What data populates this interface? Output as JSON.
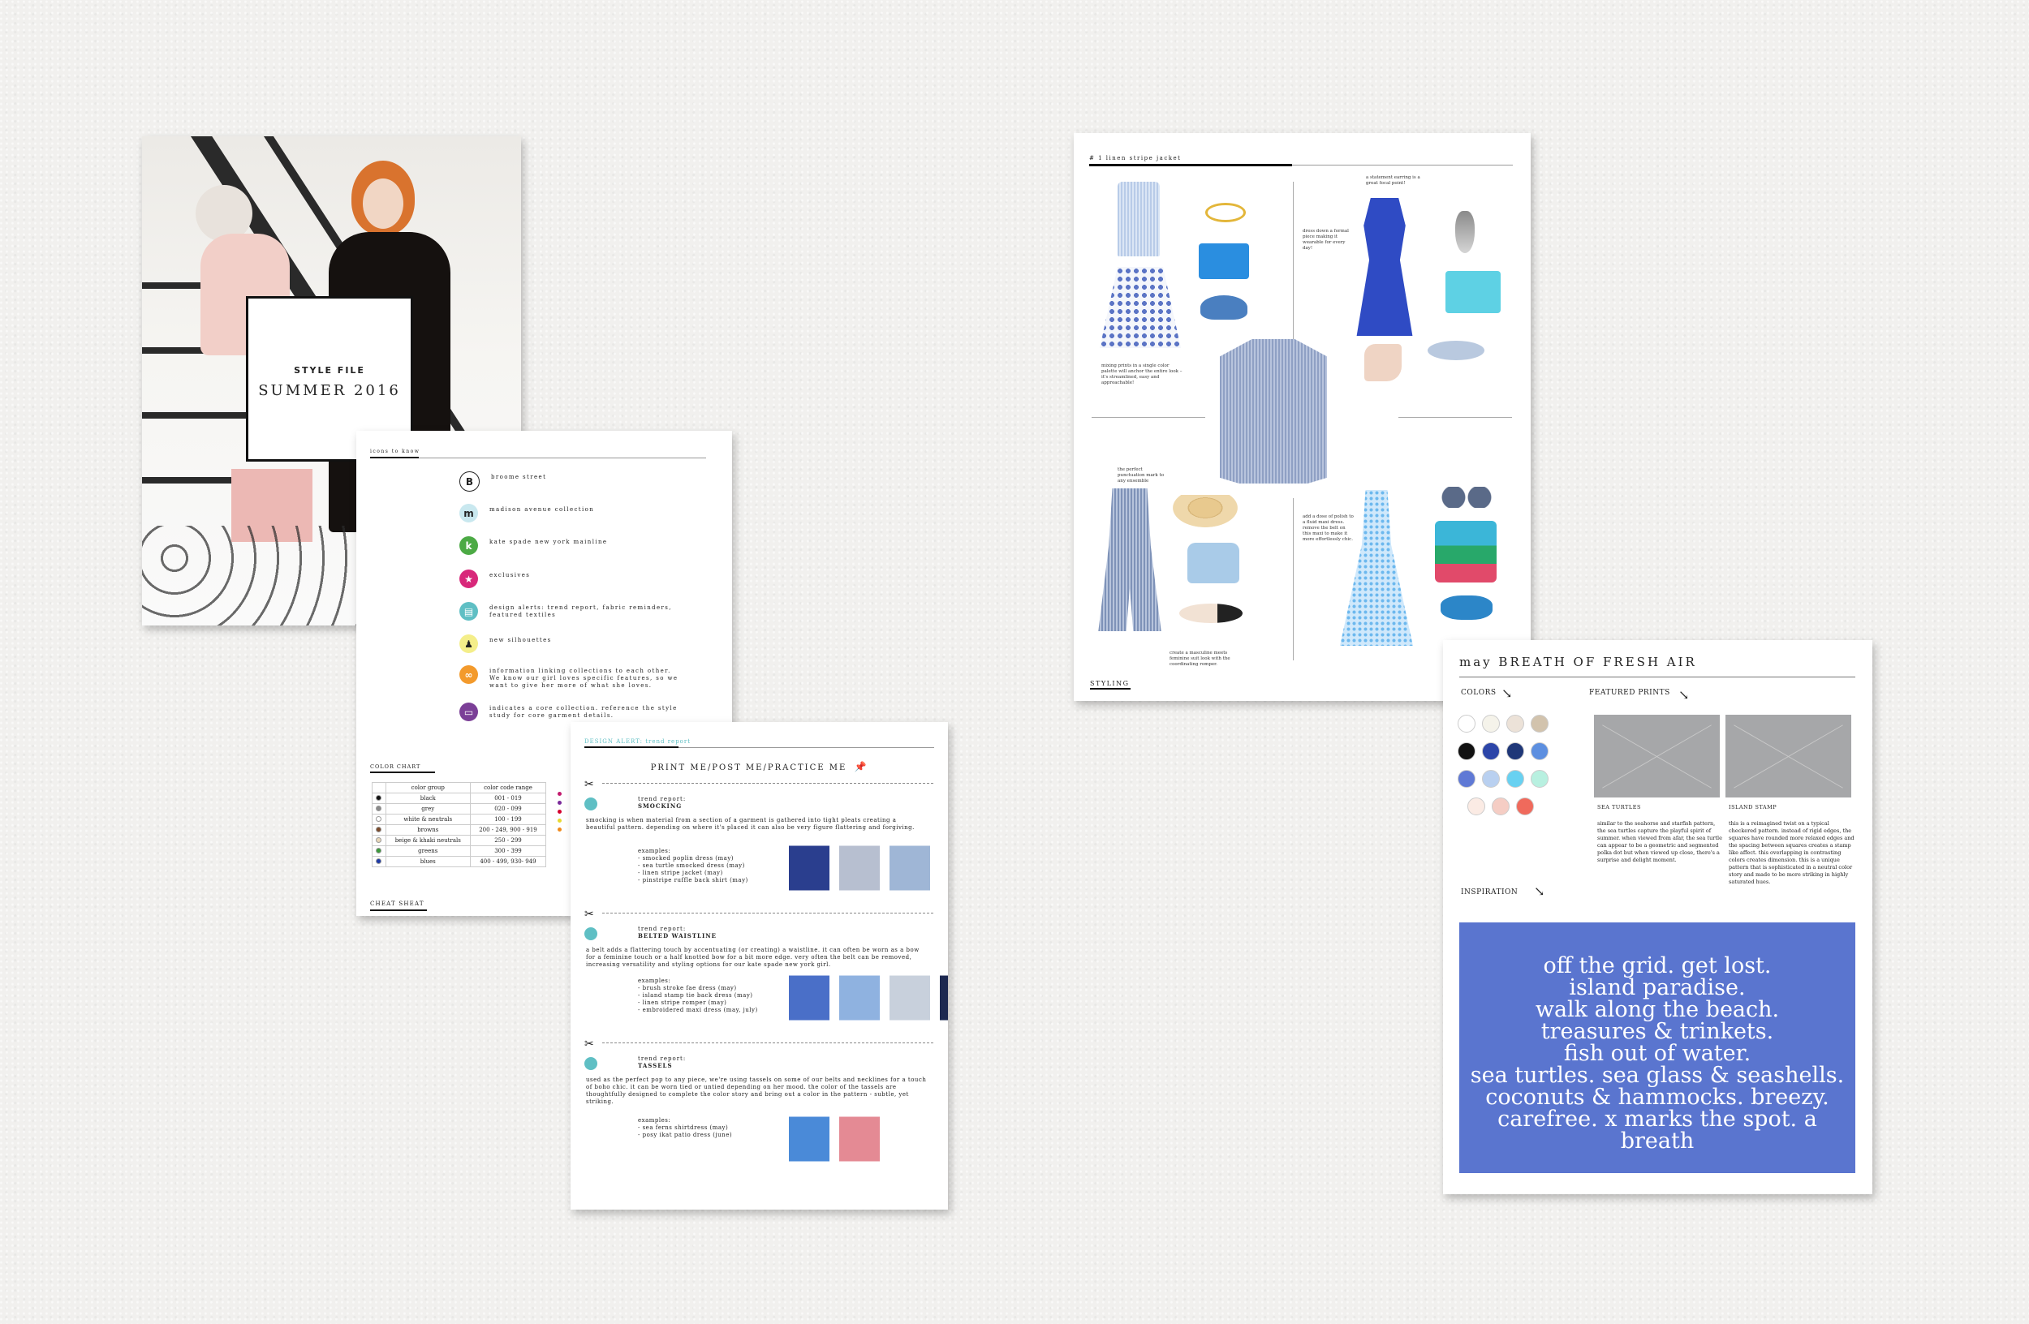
{
  "cover": {
    "line1": "STYLE FILE",
    "line2": "SUMMER 2016"
  },
  "icons_sheet": {
    "header": "icons to know",
    "items": [
      {
        "icon": "letter-b-icon",
        "glyph": "B",
        "color": "#ffffff",
        "text": "broome street"
      },
      {
        "icon": "script-m-icon",
        "glyph": "m",
        "color": "#c9e8ef",
        "text": "madison avenue collection"
      },
      {
        "icon": "letter-k-icon",
        "glyph": "k",
        "color": "#4caa45",
        "text": "kate spade new york mainline"
      },
      {
        "icon": "star-icon",
        "glyph": "★",
        "color": "#d8287a",
        "text": "exclusives"
      },
      {
        "icon": "design-alert-icon",
        "glyph": "▤",
        "color": "#5fbfc4",
        "text": "design alerts: trend report, fabric reminders, featured textiles"
      },
      {
        "icon": "dress-form-icon",
        "glyph": "♟",
        "color": "#f4ee8a",
        "text": "new silhouettes"
      },
      {
        "icon": "link-icon",
        "glyph": "∞",
        "color": "#f39a2c",
        "text": "information linking collections to each other. We know our girl loves specific features, so we want to give her more of what she loves."
      },
      {
        "icon": "core-collection-icon",
        "glyph": "▭",
        "color": "#7b3f97",
        "text": "indicates a core collection. reference the style study for core garment details."
      }
    ],
    "color_chart_title": "COLOR CHART",
    "color_chart_headers": [
      "color group",
      "color code range"
    ],
    "color_chart_rows": [
      {
        "dot": "#111111",
        "group": "black",
        "range": "001 - 019"
      },
      {
        "dot": "#8a8a8a",
        "group": "grey",
        "range": "020 - 099"
      },
      {
        "dot": "#ffffff",
        "group": "white & neutrals",
        "range": "100 - 199"
      },
      {
        "dot": "#7a4a2a",
        "group": "browns",
        "range": "200 - 249, 900 - 919"
      },
      {
        "dot": "#e8d7b8",
        "group": "beige & khaki neutrals",
        "range": "250 - 299"
      },
      {
        "dot": "#3a9a3a",
        "group": "greens",
        "range": "300 - 399"
      },
      {
        "dot": "#1d3aa8",
        "group": "blues",
        "range": "400 - 499, 930- 949"
      }
    ],
    "color_chart_extra_dots": [
      "#c21b6e",
      "#7a2a9a",
      "#d4002e",
      "#e8d930",
      "#f08a1c"
    ],
    "footer": "CHEAT SHEAT"
  },
  "print_sheet": {
    "kicker": "DESIGN ALERT: trend report",
    "title": "PRINT ME/POST ME/PRACTICE ME",
    "sections": [
      {
        "label": "trend report:",
        "name": "SMOCKING",
        "body": "smocking is when material from a section of a garment is gathered into tight pleats creating a beautiful pattern. depending on where it's placed it can also be very figure flattering and forgiving.",
        "examples": "examples:\n- smocked poplin dress (may)\n- sea turtle smocked dress (may)\n- linen stripe jacket (may)\n- pinstripe ruffle back shirt (may)"
      },
      {
        "label": "trend report:",
        "name": "BELTED WAISTLINE",
        "body": "a belt adds a flattering touch by accentuating (or creating) a waistline. it can often be worn as a bow for a feminine touch or a half knotted bow for a bit more edge. very often the belt can be removed, increasing versatility and styling options for our kate spade new york girl.",
        "examples": "examples:\n- brush stroke fae dress (may)\n- island stamp tie back dress (may)\n- linen stripe romper (may)\n- embroidered maxi dress (may, july)"
      },
      {
        "label": "trend report:",
        "name": "TASSELS",
        "body": "used as the perfect pop to any piece, we're using tassels on some of our belts and necklines for a touch of boho chic. it can be worn tied or untied depending on her mood. the color of the tassels are thoughtfully designed to complete the color story and bring out a color in the pattern - subtle, yet striking.",
        "examples": "examples:\n- sea ferns shirtdress (may)\n- posy ikat patio dress (june)"
      }
    ]
  },
  "styling_sheet": {
    "header": "# 1 linen stripe jacket",
    "footer": "STYLING",
    "notes": [
      "mixing prints in a single color palette will anchor the entire look – it's streamlined, easy and approachable!",
      "a statement earring is a great focal point!",
      "dress down a formal piece making it wearable for every day!",
      "the perfect punctuation mark to any ensemble",
      "create a masculine meets feminine suit look with the coordinating romper.",
      "add a dose of polish to a fluid maxi dress. remove the belt on this maxi to make it more effortlessly chic."
    ]
  },
  "may_sheet": {
    "month": "may",
    "title": "BREATH OF FRESH AIR",
    "colors_label": "COLORS",
    "prints_label": "FEATURED PRINTS",
    "swatches": [
      "#ffffff",
      "#f5f3ea",
      "#ece2d8",
      "#d2c3ad",
      "#111111",
      "#2c45a8",
      "#1f3778",
      "#5d8fe0",
      "#5f79d5",
      "#b9d0f0",
      "#68d1f1",
      "#b8f0e0",
      "#fbebe4",
      "#f5cdc4",
      "#f06a5c"
    ],
    "prints": [
      {
        "name": "SEA TURTLES",
        "desc": "similar to the seahorse and starfish pattern, the sea turtles capture the playful spirit of summer. when viewed from afar, the sea turtle can appear to be a geometric and segmented polka dot but when viewed up close, there's a surprise and delight moment."
      },
      {
        "name": "ISLAND STAMP",
        "desc": "this is a reimagined twist on a typical checkered pattern. instead of rigid edges, the squares have rounded more relaxed edges and the spacing between squares creates a stamp like affect. this overlapping in contrasting colors creates dimension. this is a unique pattern that is sophisticated in a neutral color story and made to be more striking in highly saturated hues."
      }
    ],
    "inspiration_label": "INSPIRATION",
    "inspiration_lines": [
      "off the grid. get lost.",
      "island paradise.",
      "walk along the beach.",
      "treasures & trinkets.",
      "fish out of water.",
      "sea turtles. sea glass & seashells.",
      "coconuts & hammocks. breezy.",
      "carefree. x marks the spot. a breath"
    ]
  }
}
